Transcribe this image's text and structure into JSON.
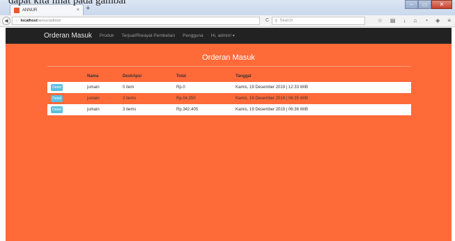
{
  "caption": "dapat kita lihat pada gambar",
  "browser": {
    "tab_title": "ANNUR",
    "tab_close": "×",
    "new_tab": "+",
    "window_controls": [
      "–",
      "▭",
      "✕"
    ],
    "url_info": "ⓘ",
    "url_host": "localhost",
    "url_path": "/annur/admin/",
    "reload": "C",
    "search_placeholder": "Search",
    "toolbar_icons": [
      "star-icon",
      "clipboard-icon",
      "download-icon",
      "home-icon",
      "pocket-icon",
      "shield-icon",
      "menu-icon"
    ],
    "toolbar_glyphs": [
      "☆",
      "▤",
      "↓",
      "⌂",
      "◔",
      "◈",
      "≡"
    ]
  },
  "app": {
    "brand": "Orderan Masuk",
    "nav": [
      "Produk",
      "Terjual/Riwayat Pembelian",
      "Pengguna",
      "Hi, admin!"
    ],
    "page_title": "Orderan Masuk"
  },
  "table": {
    "columns": [
      "Nama",
      "Deskripsi",
      "Total",
      "Tanggal"
    ],
    "detail_label": "Detail",
    "rows": [
      {
        "nama": "jumain",
        "deskripsi": "0 item",
        "total": "Rp.0",
        "tanggal": "Kamis, 19 Desember 2019 | 12:33 WIB"
      },
      {
        "nama": "jumain",
        "deskripsi": "2 items",
        "total": "Rp.04.350",
        "tanggal": "Kamis, 19 Desember 2019 | 06:35 WIB"
      },
      {
        "nama": "jumain",
        "deskripsi": "3 items",
        "total": "Rp.342.405",
        "tanggal": "Kamis, 19 Desember 2019 | 06:36 WIB"
      }
    ]
  },
  "colors": {
    "page_bg": "#ff6a39",
    "navbar_bg": "#222222",
    "detail_button": "#5bc0de"
  }
}
